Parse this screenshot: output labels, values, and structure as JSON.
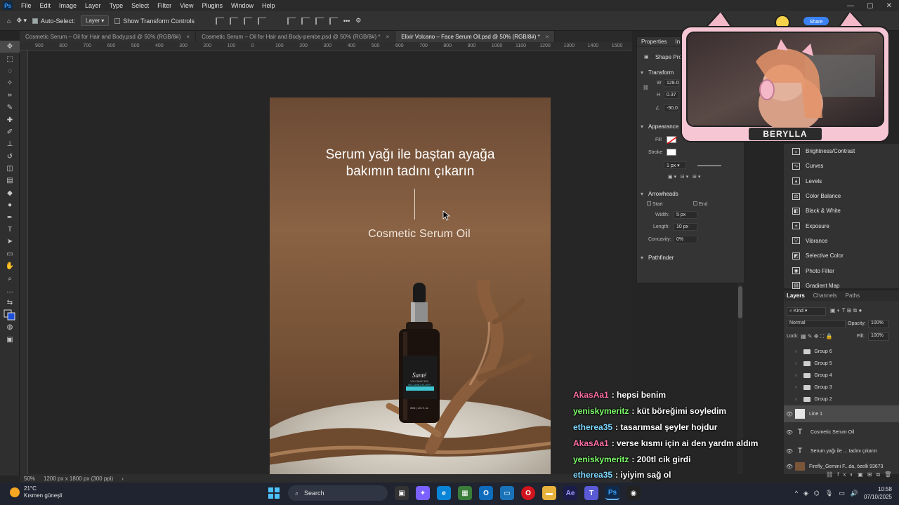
{
  "menubar": {
    "app_icon": "Ps",
    "items": [
      "File",
      "Edit",
      "Image",
      "Layer",
      "Type",
      "Select",
      "Filter",
      "View",
      "Plugins",
      "Window",
      "Help"
    ]
  },
  "options": {
    "auto_select": "Auto-Select:",
    "layer_select": "Layer",
    "show_transform": "Show Transform Controls"
  },
  "tabs": [
    {
      "label": "Cosmetic Serum – Oil for Hair and Body.psd @ 50% (RGB/8#)"
    },
    {
      "label": "Cosmetic Serum – Oil for Hair and Body-pembe.psd @ 50% (RGB/8#) *"
    },
    {
      "label": "Elixir Volcano – Face Serum Oil.psd @ 50% (RGB/8#) *"
    }
  ],
  "ruler_ticks": [
    "900",
    "800",
    "700",
    "600",
    "500",
    "400",
    "300",
    "200",
    "100",
    "0",
    "100",
    "200",
    "300",
    "400",
    "500",
    "600",
    "700",
    "800",
    "900",
    "1000",
    "1100",
    "1200",
    "1300",
    "1400",
    "1500"
  ],
  "artboard": {
    "headline_line1": "Serum yağı ile baştan ayağa",
    "headline_line2": "bakımın tadını çıkarın",
    "subtitle": "Cosmetic Serum Oil",
    "bottle_brand": "Santé",
    "bottle_sub": "VOLCANIC SPA",
    "bottle_product": "VELZANO ELIXIR",
    "bottle_volume": "30ml | 1.01 fl. oz."
  },
  "status": {
    "zoom": "50%",
    "doc_size": "1200 px x 1800 px (300 ppi)"
  },
  "properties": {
    "tabs": [
      "Properties",
      "In"
    ],
    "shape_props": "Shape Pro",
    "transform": "Transform",
    "w_label": "W",
    "w_value": "128.0",
    "h_label": "H",
    "h_value": "0.37",
    "angle_value": "-90.0",
    "appearance": "Appearance",
    "fill": "Fill",
    "stroke": "Stroke",
    "stroke_width": "1 px",
    "arrowheads": "Arrowheads",
    "start": "Start",
    "end": "End",
    "width_label": "Width:",
    "width_value": "5 px",
    "length_label": "Length:",
    "length_value": "10 px",
    "concavity_label": "Concavity:",
    "concavity_value": "0%",
    "pathfinder": "Pathfinder"
  },
  "adjustments": [
    "Brightness/Contrast",
    "Curves",
    "Levels",
    "Color Balance",
    "Black & White",
    "Exposure",
    "Vibrance",
    "Selective Color",
    "Photo Filter",
    "Gradient Map"
  ],
  "layers_panel": {
    "tabs": [
      "Layers",
      "Channels",
      "Paths"
    ],
    "kind": "Kind",
    "blend": "Normal",
    "opacity_label": "Opacity:",
    "opacity": "100%",
    "lock_label": "Lock:",
    "fill_label": "Fill:",
    "fill": "100%",
    "rows": [
      {
        "type": "group",
        "name": "Group 6"
      },
      {
        "type": "group",
        "name": "Group 5"
      },
      {
        "type": "group",
        "name": "Group 4"
      },
      {
        "type": "group",
        "name": "Group 3"
      },
      {
        "type": "group",
        "name": "Group 2"
      },
      {
        "type": "shape",
        "name": "Line 1"
      },
      {
        "type": "text",
        "name": "Cosmetic Serum Oil"
      },
      {
        "type": "text",
        "name": "Serum yağı ile ... tadını çıkarın"
      },
      {
        "type": "image",
        "name": "Firefly_Gemini F...da, özelli 93673"
      }
    ]
  },
  "webcam": {
    "name": "BERYLLA",
    "share": "Share"
  },
  "chat": [
    {
      "user": "AkasAa1",
      "color": "#ff6fa5",
      "text": ": hepsi benim"
    },
    {
      "user": "yeniskymeritz",
      "color": "#7dff6a",
      "text": ": küt böreğimi soyledim"
    },
    {
      "user": "etherea35",
      "color": "#7fd8ff",
      "text": ": tasarımsal şeyler hojdur"
    },
    {
      "user": "AkasAa1",
      "color": "#ff6fa5",
      "text": ": verse kısmı için ai den yardm aldım"
    },
    {
      "user": "yeniskymeritz",
      "color": "#7dff6a",
      "text": ": 200tl cik girdi"
    },
    {
      "user": "etherea35",
      "color": "#7fd8ff",
      "text": ": iyiyim sağ ol"
    }
  ],
  "taskbar": {
    "temp": "21°C",
    "weather": "Kısmen güneşli",
    "search": "Search",
    "time": "10:58",
    "date": "07/10/2025"
  }
}
